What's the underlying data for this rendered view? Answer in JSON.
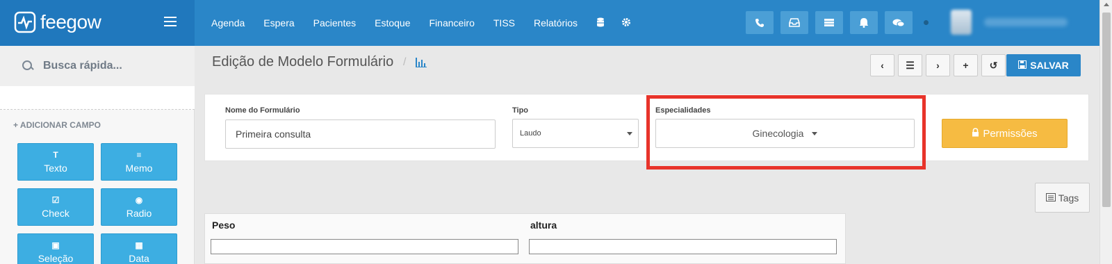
{
  "app": {
    "logo_text": "feegow",
    "brand_color": "#2a86c8"
  },
  "nav": {
    "items": [
      "Agenda",
      "Espera",
      "Pacientes",
      "Estoque",
      "Financeiro",
      "TISS",
      "Relatórios"
    ],
    "icons": [
      "database-icon",
      "gear-icon"
    ]
  },
  "top_buttons": [
    "phone-icon",
    "inbox-icon",
    "server-icon",
    "bell-icon",
    "chat-icon"
  ],
  "sidebar": {
    "search_placeholder": "Busca rápida...",
    "add_field_label": "ADICIONAR CAMPO",
    "field_buttons": [
      {
        "label": "Texto",
        "icon": "text-icon"
      },
      {
        "label": "Memo",
        "icon": "lines-icon"
      },
      {
        "label": "Check",
        "icon": "checkbox-icon"
      },
      {
        "label": "Radio",
        "icon": "radio-icon"
      },
      {
        "label": "Seleção",
        "icon": "select-icon"
      },
      {
        "label": "Data",
        "icon": "calendar-icon"
      }
    ]
  },
  "page": {
    "title": "Edição de Modelo Formulário",
    "separator": "/",
    "save_label": "SALVAR"
  },
  "form": {
    "name_label": "Nome do Formulário",
    "name_value": "Primeira consulta",
    "type_label": "Tipo",
    "type_value": "Laudo",
    "specialties_label": "Especialidades",
    "specialties_value": "Ginecologia",
    "permissions_label": "Permissões"
  },
  "tags_label": "Tags",
  "fields": {
    "peso_label": "Peso",
    "altura_label": "altura"
  }
}
